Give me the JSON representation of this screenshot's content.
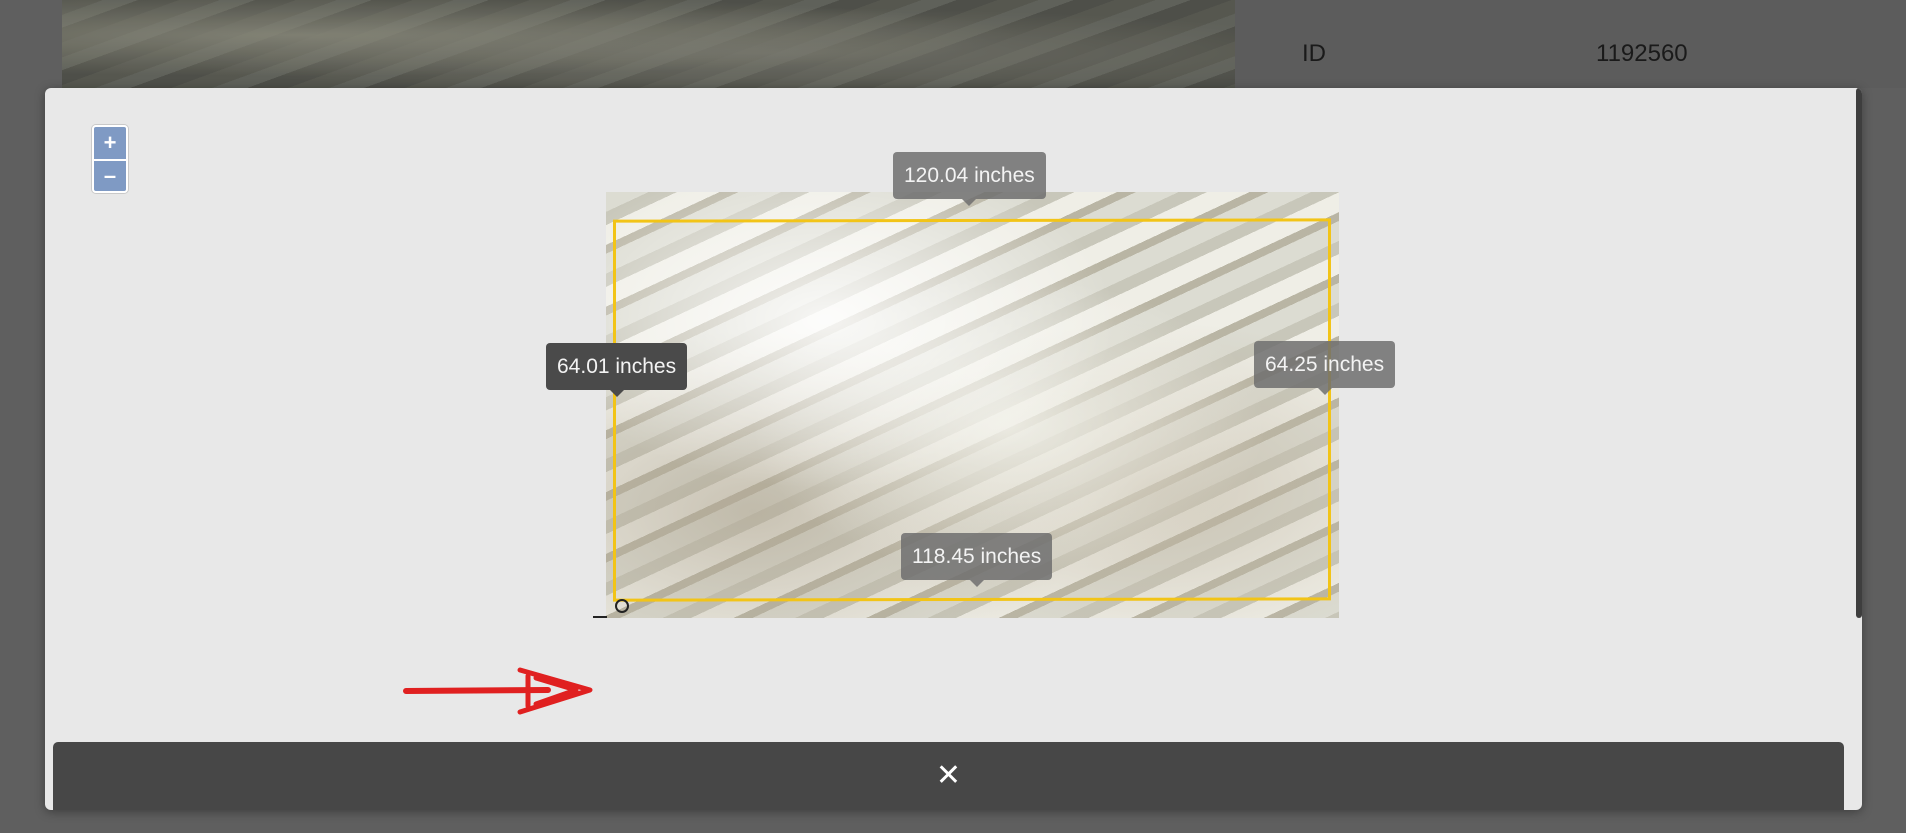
{
  "background_page": {
    "detail_label": "ID",
    "detail_value": "1192560"
  },
  "viewer": {
    "zoom_in_label": "+",
    "zoom_out_label": "–",
    "dimensions": {
      "top": "120.04 inches",
      "left": "64.01 inches",
      "right": "64.25 inches",
      "bottom": "118.45 inches"
    }
  },
  "close_button": {
    "icon_glyph": "✕"
  },
  "colors": {
    "accent_rect": "#f2c417",
    "zoom_button": "#7f9ac4",
    "annotation_arrow": "#e02020"
  },
  "icons": {
    "close": "close-icon",
    "zoom_in": "plus-icon",
    "zoom_out": "minus-icon",
    "corner": "corner-handle-icon",
    "annotation": "red-arrow-icon"
  }
}
